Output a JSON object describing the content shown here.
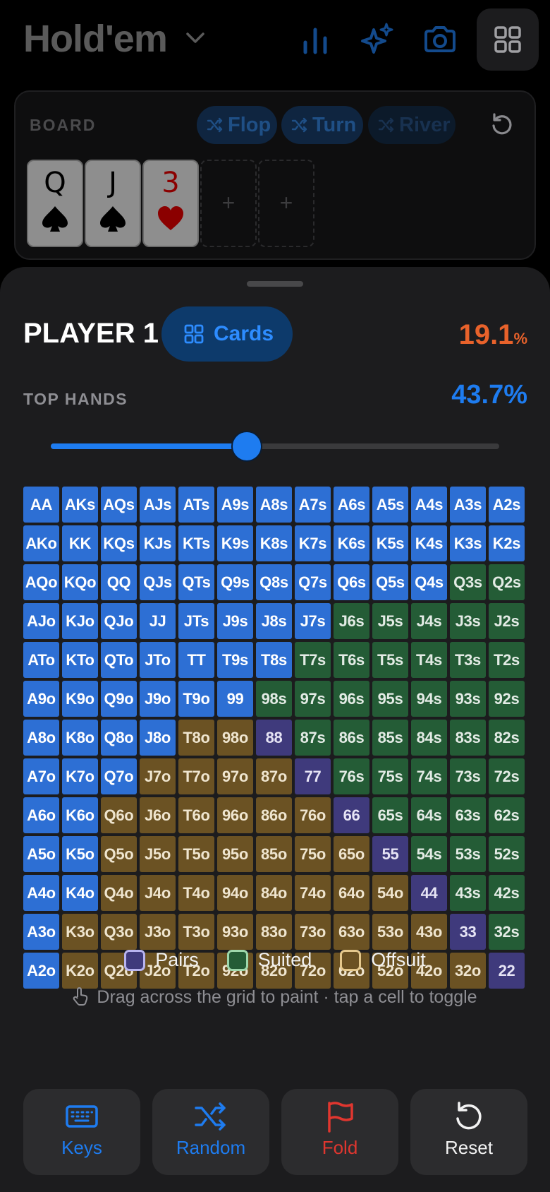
{
  "header": {
    "title": "Hold'em",
    "icons": [
      "bar-chart-icon",
      "sparkles-icon",
      "camera-icon",
      "grid-icon"
    ]
  },
  "board": {
    "label": "BOARD",
    "pills": {
      "flop": "Flop",
      "turn": "Turn",
      "river": "River"
    },
    "cards": [
      {
        "rank": "Q",
        "suit": "spade"
      },
      {
        "rank": "J",
        "suit": "spade"
      },
      {
        "rank": "3",
        "suit": "heart"
      }
    ],
    "empty_slot": "+"
  },
  "player": {
    "name": "PLAYER 1",
    "mode": "Cards",
    "equity": "19.1",
    "equity_unit": "%",
    "top_hands_label": "TOP HANDS",
    "top_hands_value": "43.7%",
    "slider_fraction": 0.437
  },
  "grid": {
    "rows": [
      [
        "AA",
        "AKs",
        "AQs",
        "AJs",
        "ATs",
        "A9s",
        "A8s",
        "A7s",
        "A6s",
        "A5s",
        "A4s",
        "A3s",
        "A2s"
      ],
      [
        "AKo",
        "KK",
        "KQs",
        "KJs",
        "KTs",
        "K9s",
        "K8s",
        "K7s",
        "K6s",
        "K5s",
        "K4s",
        "K3s",
        "K2s"
      ],
      [
        "AQo",
        "KQo",
        "QQ",
        "QJs",
        "QTs",
        "Q9s",
        "Q8s",
        "Q7s",
        "Q6s",
        "Q5s",
        "Q4s",
        "Q3s",
        "Q2s"
      ],
      [
        "AJo",
        "KJo",
        "QJo",
        "JJ",
        "JTs",
        "J9s",
        "J8s",
        "J7s",
        "J6s",
        "J5s",
        "J4s",
        "J3s",
        "J2s"
      ],
      [
        "ATo",
        "KTo",
        "QTo",
        "JTo",
        "TT",
        "T9s",
        "T8s",
        "T7s",
        "T6s",
        "T5s",
        "T4s",
        "T3s",
        "T2s"
      ],
      [
        "A9o",
        "K9o",
        "Q9o",
        "J9o",
        "T9o",
        "99",
        "98s",
        "97s",
        "96s",
        "95s",
        "94s",
        "93s",
        "92s"
      ],
      [
        "A8o",
        "K8o",
        "Q8o",
        "J8o",
        "T8o",
        "98o",
        "88",
        "87s",
        "86s",
        "85s",
        "84s",
        "83s",
        "82s"
      ],
      [
        "A7o",
        "K7o",
        "Q7o",
        "J7o",
        "T7o",
        "97o",
        "87o",
        "77",
        "76s",
        "75s",
        "74s",
        "73s",
        "72s"
      ],
      [
        "A6o",
        "K6o",
        "Q6o",
        "J6o",
        "T6o",
        "96o",
        "86o",
        "76o",
        "66",
        "65s",
        "64s",
        "63s",
        "62s"
      ],
      [
        "A5o",
        "K5o",
        "Q5o",
        "J5o",
        "T5o",
        "95o",
        "85o",
        "75o",
        "65o",
        "55",
        "54s",
        "53s",
        "52s"
      ],
      [
        "A4o",
        "K4o",
        "Q4o",
        "J4o",
        "T4o",
        "94o",
        "84o",
        "74o",
        "64o",
        "54o",
        "44",
        "43s",
        "42s"
      ],
      [
        "A3o",
        "K3o",
        "Q3o",
        "J3o",
        "T3o",
        "93o",
        "83o",
        "73o",
        "63o",
        "53o",
        "43o",
        "33",
        "32s"
      ],
      [
        "A2o",
        "K2o",
        "Q2o",
        "J2o",
        "T2o",
        "92o",
        "82o",
        "72o",
        "62o",
        "52o",
        "42o",
        "32o",
        "22"
      ]
    ],
    "selected_per_row": [
      13,
      13,
      11,
      8,
      7,
      6,
      4,
      3,
      2,
      2,
      2,
      1,
      1
    ]
  },
  "legend": {
    "pairs": "Pairs",
    "suited": "Suited",
    "offsuit": "Offsuit"
  },
  "hint": "Drag across the grid to paint · tap a cell to toggle",
  "buttons": {
    "keys": "Keys",
    "random": "Random",
    "fold": "Fold",
    "reset": "Reset"
  },
  "colors": {
    "accent": "#1e7cf0",
    "equity": "#e8622b",
    "fold": "#e0362f",
    "selected": "#2d6fd4",
    "suited": "#245c36",
    "offsuit": "#6b5223",
    "pair": "#3f3a7c"
  }
}
